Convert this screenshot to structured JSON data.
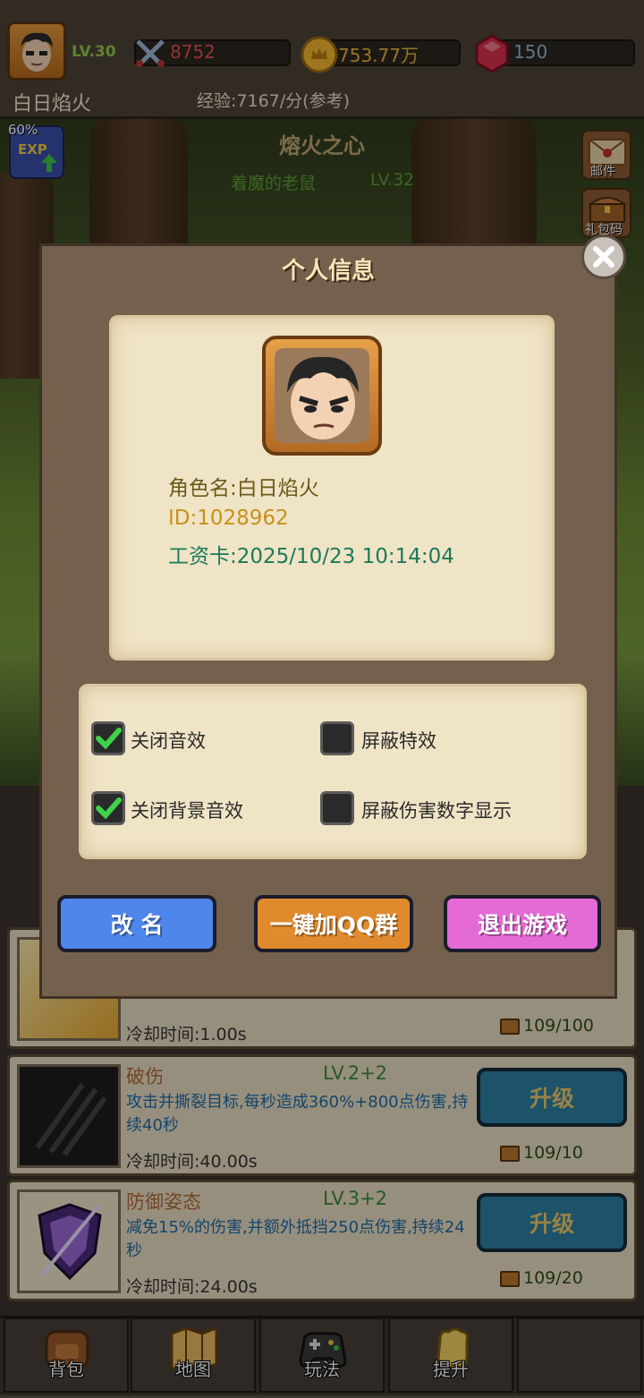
{
  "header": {
    "player_level": "LV.30",
    "power": "8752",
    "gold": "753.77万",
    "gems": "150",
    "player_name": "白日焰火",
    "exp_rate": "经验:7167/分(参考)"
  },
  "stage": {
    "title": "熔火之心",
    "enemy_name": "着魔的老鼠",
    "enemy_level": "LV.32",
    "exp_percent": "60%",
    "exp_badge": "EXP"
  },
  "side_menu": {
    "mail_label": "邮件",
    "gift_code_label": "礼包码"
  },
  "modal": {
    "title": "个人信息",
    "role_name": "角色名:白日焰火",
    "id": "ID:1028962",
    "salary_card": "工资卡:2025/10/23 10:14:04",
    "options": [
      {
        "label": "关闭音效",
        "checked": true
      },
      {
        "label": "屏蔽特效",
        "checked": false
      },
      {
        "label": "关闭背景音效",
        "checked": true
      },
      {
        "label": "屏蔽伤害数字显示",
        "checked": false
      }
    ],
    "rename_button": "改 名",
    "qq_group_button": "一键加QQ群",
    "exit_button": "退出游戏"
  },
  "skills": [
    {
      "name": "",
      "level": "",
      "desc": "",
      "cooldown": "冷却时间:1.00s",
      "cost": "109/100",
      "button": ""
    },
    {
      "name": "破伤",
      "level": "LV.2+2",
      "desc": "攻击并撕裂目标,每秒造成360%+800点伤害,持续40秒",
      "cooldown": "冷却时间:40.00s",
      "cost": "109/10",
      "button": "升级"
    },
    {
      "name": "防御姿态",
      "level": "LV.3+2",
      "desc": "减免15%的伤害,并额外抵挡250点伤害,持续24秒",
      "cooldown": "冷却时间:24.00s",
      "cost": "109/20",
      "button": "升级"
    }
  ],
  "nav": {
    "bag": "背包",
    "map": "地图",
    "gameplay": "玩法",
    "upgrade": "提升"
  },
  "colors": {
    "rename": "#4f86ec",
    "qq_group": "#e08a2e",
    "exit": "#e46ad6"
  }
}
